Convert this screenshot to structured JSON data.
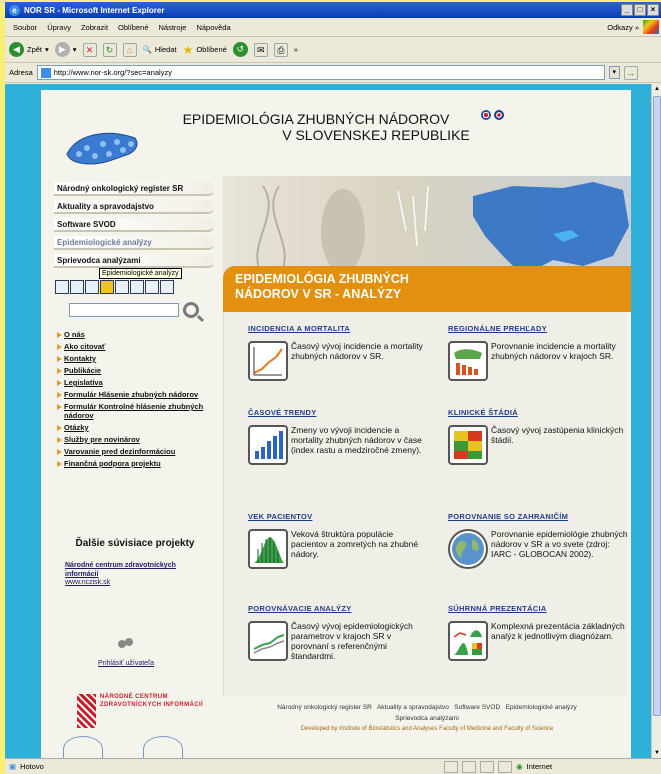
{
  "window": {
    "title": "NOR SR - Microsoft Internet Explorer"
  },
  "menu": {
    "items": [
      "Soubor",
      "Úpravy",
      "Zobrazit",
      "Oblíbené",
      "Nástroje",
      "Nápověda"
    ],
    "links_label": "Odkazy"
  },
  "toolbar": {
    "back": "Zpět",
    "search": "Hledat",
    "favorites": "Oblíbené"
  },
  "address": {
    "label": "Adresa",
    "url": "http://www.nor-sk.org/?sec=analyzy"
  },
  "status": {
    "text": "Hotovo",
    "zone": "Internet"
  },
  "site": {
    "title_line1": "EPIDEMIOLÓGIA ZHUBNÝCH NÁDOROV",
    "title_line2": "V SLOVENSKEJ REPUBLIKE",
    "hero_line1": "EPIDEMIOLÓGIA ZHUBNÝCH",
    "hero_line2": "NÁDOROV V SR - ANALÝZY"
  },
  "nav": [
    {
      "label": "Národný onkologický register SR"
    },
    {
      "label": "Aktuality a spravodajstvo"
    },
    {
      "label": "Software SVOD"
    },
    {
      "label": "Epidemiologické analýzy"
    },
    {
      "label": "Sprievodca analýzami"
    }
  ],
  "tooltip": "Epidemiologické analýzy",
  "links": [
    "O nás",
    "Ako citovať",
    "Kontakty",
    "Publikácie",
    "Legislatíva",
    "Formulár Hlásenie zhubných nádorov",
    "Formulár Kontrolné hlásenie zhubných nádorov",
    "Otázky",
    "Služby pre novinárov",
    "Varovanie pred dezinformáciou",
    "Finančná podpora projektu"
  ],
  "related": {
    "heading": "Ďalšie súvisiace projekty",
    "link": "Národné centrum zdravotníckych informácií",
    "url": "www.nczisk.sk"
  },
  "login": "Prihlásiť užívateľa",
  "nczi_logo_text": "NÁRODNÉ CENTRUM ZDRAVOTNÍCKYCH INFORMÁCIÍ",
  "sections": {
    "inc": {
      "title": "INCIDENCIA A MORTALITA",
      "text": "Časový vývoj incidencie a mortality zhubných nádorov v SR."
    },
    "reg": {
      "title": "REGIONÁLNE PREHĽADY",
      "text": "Porovnanie incidencie a mortality zhubných nádorov v krajoch SR."
    },
    "trend": {
      "title": "ČASOVÉ TRENDY",
      "text": "Zmeny vo vývoji incidencie a mortality zhubných nádorov v čase (index rastu a medziročné zmeny)."
    },
    "stage": {
      "title": "KLINICKÉ ŠTÁDIÁ",
      "text": "Časový vývoj zastúpenia klinických štádií."
    },
    "age": {
      "title": "VEK PACIENTOV",
      "text": "Veková štruktúra populácie pacientov a zomretých na zhubné nádory."
    },
    "comp": {
      "title": "POROVNANIE SO ZAHRANIČÍM",
      "text": "Porovnanie epidemiológie zhubných nádorov v SR a vo svete (zdroj: IARC - GLOBOCAN 2002)."
    },
    "cmp": {
      "title": "POROVNÁVACIE ANALÝZY",
      "text": "Časový vývoj epidemiologických parametrov v krajoch SR v porovnaní s referenčnými štandardmi."
    },
    "sum": {
      "title": "SÚHRNNÁ PREZENTÁCIA",
      "text": "Komplexná prezentácia základných analýz k jednotlivým diagnózam."
    }
  },
  "footer": {
    "links": [
      "Národný onkologický register SR",
      "Aktuality a spravodajstvo",
      "Software SVOD",
      "Epidemiologické analýzy",
      "Sprievodca analýzami"
    ],
    "credit": "Developed by Institute of Biostatistics and Analyses Faculty of Medicine and Faculty of Science"
  },
  "colors": {
    "accent": "#e2900e",
    "page_bg": "#2eb0d9",
    "link": "#1f3c8a"
  }
}
